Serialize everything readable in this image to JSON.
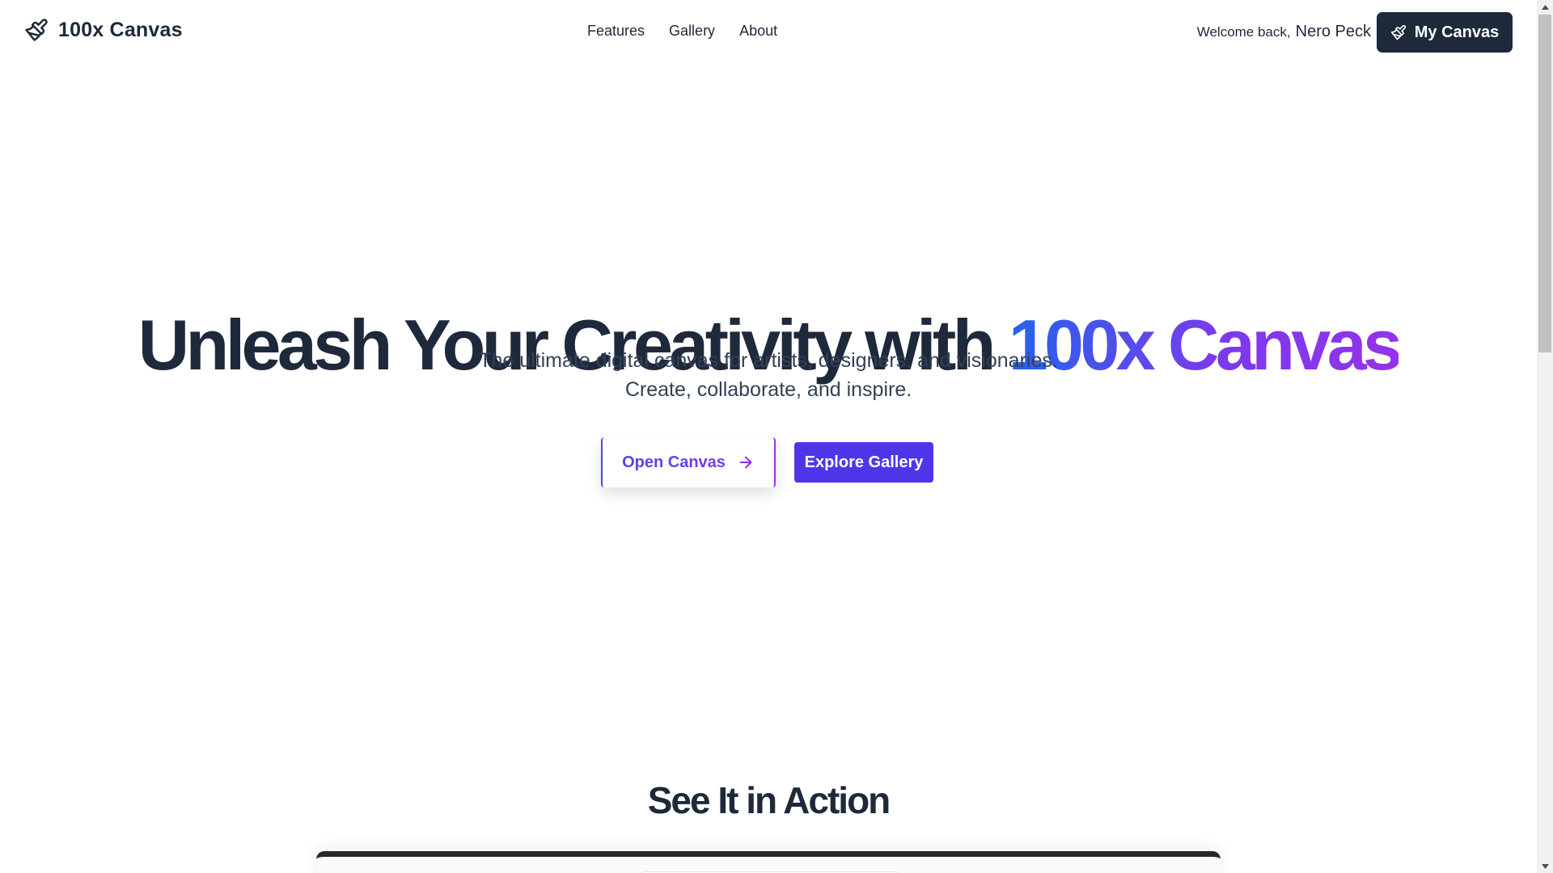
{
  "header": {
    "brand_name": "100x Canvas",
    "brand_icon": "paintbrush-icon",
    "nav": [
      {
        "label": "Features"
      },
      {
        "label": "Gallery"
      },
      {
        "label": "About"
      }
    ],
    "welcome_text": "Welcome back,",
    "user_name": "Nero Peck",
    "my_canvas_label": "My Canvas",
    "my_canvas_icon": "paintbrush-icon"
  },
  "hero": {
    "title_prefix": "Unleash Your Creativity with",
    "title_highlight": "100x Canvas",
    "subtitle": "The ultimate digital canvas for artists, designers, and visionaries. Create, collaborate, and inspire.",
    "open_canvas_label": "Open Canvas",
    "open_canvas_icon": "arrow-right-icon",
    "explore_gallery_label": "Explore Gallery"
  },
  "section": {
    "title": "See It in Action"
  },
  "colors": {
    "text_dark": "#1e293b",
    "accent_blue": "#2563eb",
    "accent_purple": "#9333ea",
    "explore_button": "#4f35ea",
    "my_canvas_button": "#1e293b"
  }
}
